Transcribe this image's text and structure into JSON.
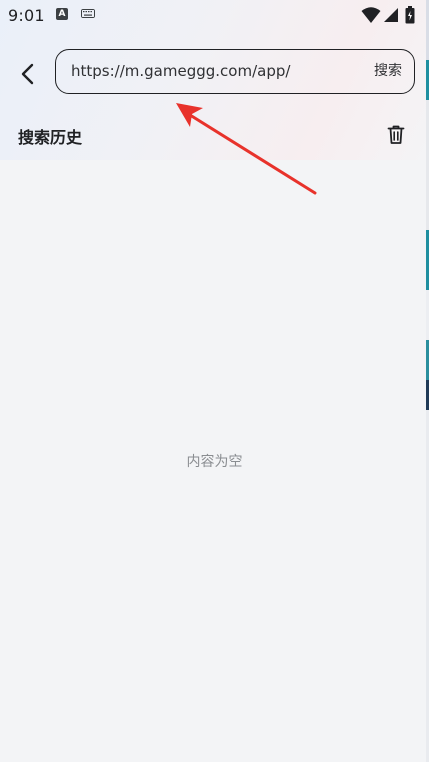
{
  "status_bar": {
    "time": "9:01",
    "notification_icons": [
      "keyboard-a-icon",
      "keyboard-icon"
    ],
    "system_icons": [
      "wifi-icon",
      "signal-icon",
      "battery-icon"
    ]
  },
  "header": {
    "back_icon": "chevron-left-icon",
    "search": {
      "value": "https://m.gameggg.com/app/",
      "button_label": "搜索"
    }
  },
  "history": {
    "title": "搜索历史",
    "delete_icon": "trash-icon",
    "empty_text": "内容为空"
  },
  "annotation": {
    "arrow_color": "#e8322b"
  },
  "colors": {
    "background": "#f3f4f6",
    "text_primary": "#202124",
    "text_muted": "#8a8d91",
    "accent_edge": "#1e8fa0"
  }
}
